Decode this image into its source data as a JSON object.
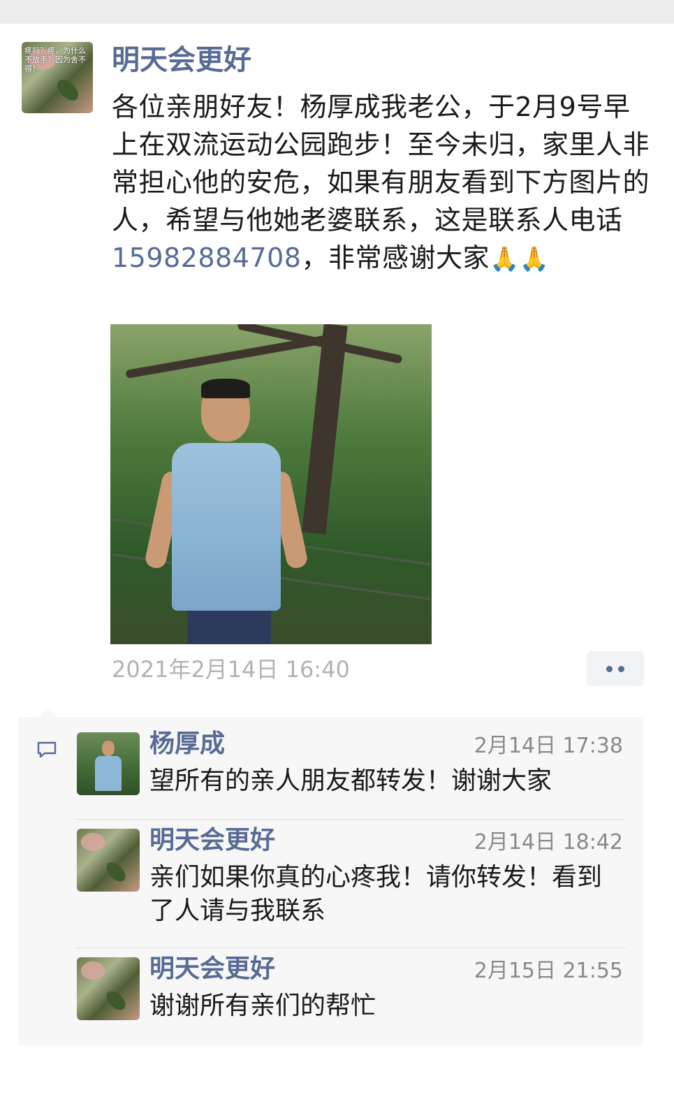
{
  "post": {
    "author": "明天会更好",
    "avatar_caption": "疼吗？疼，为什么不放手？因为舍不得！",
    "text_before_phone": "各位亲朋好友！杨厚成我老公，于2月9号早上在双流运动公园跑步！至今未归，家里人非常担心他的安危，如果有朋友看到下方图片的人，希望与他她老婆联系，这是联系人电话",
    "phone": "15982884708",
    "text_after_phone": "，非常感谢大家",
    "emoji": "🙏🙏",
    "timestamp": "2021年2月14日 16:40"
  },
  "comments": [
    {
      "author": "杨厚成",
      "time": "2月14日 17:38",
      "text": "望所有的亲人朋友都转发！谢谢大家"
    },
    {
      "author": "明天会更好",
      "time": "2月14日 18:42",
      "text": "亲们如果你真的心疼我！请你转发！看到了人请与我联系"
    },
    {
      "author": "明天会更好",
      "time": "2月15日 21:55",
      "text": "谢谢所有亲们的帮忙"
    }
  ],
  "colors": {
    "link": "#576b95",
    "timestamp": "#b2b2b2",
    "comment_bg": "#f7f7f7"
  },
  "icons": {
    "more": "more-dots-icon",
    "comment": "comment-bubble-icon"
  }
}
